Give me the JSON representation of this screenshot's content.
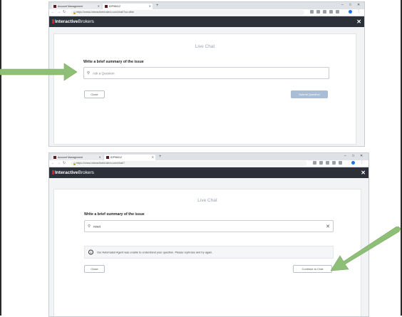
{
  "colors": {
    "ib_header": "#2b3039",
    "ib_brand_red": "#d81f26",
    "arrow_green": "#8fbf76",
    "submit_disabled": "#a9bdd6"
  },
  "screens": [
    {
      "browser": {
        "tabs": [
          {
            "label": "Account Management",
            "active": false
          },
          {
            "label": "IDP98412",
            "active": true
          }
        ],
        "url": "https://nmsci.interactivebrokers.com/chat/?sn=dfde"
      },
      "header": {
        "logo_bold": "Interactive",
        "logo_light": "Brokers",
        "close_icon": "close-icon"
      },
      "card": {
        "title": "Live Chat",
        "field_label": "Write a brief summary of the issue",
        "input_placeholder": "Ask a Question",
        "input_value": "",
        "close_button": "Close",
        "primary_button": "Submit Question",
        "primary_disabled": true
      }
    },
    {
      "browser": {
        "tabs": [
          {
            "label": "Account Management",
            "active": false
          },
          {
            "label": "IDP98412",
            "active": true
          }
        ],
        "url": "https://nmsci.interactivebrokers.com/chat/?"
      },
      "header": {
        "logo_bold": "Interactive",
        "logo_light": "Brokers",
        "close_icon": "close-icon"
      },
      "card": {
        "title": "Live Chat",
        "field_label": "Write a brief summary of the issue",
        "input_placeholder": "",
        "input_value": "reset",
        "notice": "Our Automated Agent was unable to understand your question. Please rephrase and try again.",
        "close_button": "Close",
        "primary_button": "Continue to Chat",
        "primary_disabled": false
      }
    }
  ],
  "annotations": {
    "arrow_icon": "right-arrow-icon",
    "arrow_2_icon": "down-left-arrow-icon"
  }
}
